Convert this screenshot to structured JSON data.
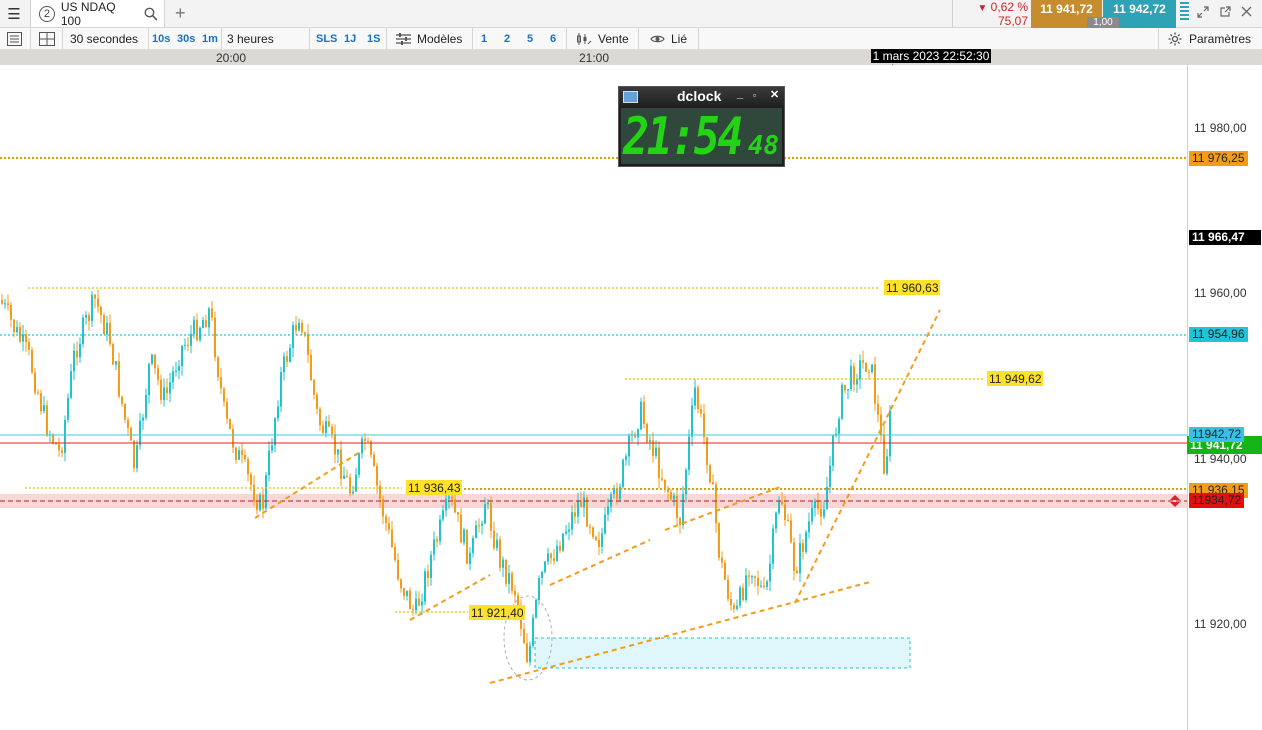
{
  "header": {
    "tab_number": "2",
    "instrument": "US NDAQ 100",
    "change_percent": "0,62 %",
    "change_points": "75,07",
    "bid": "11 941,72",
    "ask": "11 942,72",
    "quantity": "1,00"
  },
  "toolbar": {
    "interval": "30 secondes",
    "btn_10s": "10s",
    "btn_30s": "30s",
    "btn_1m": "1m",
    "range": "3 heures",
    "btn_sls": "SLS",
    "btn_1j": "1J",
    "btn_1s": "1S",
    "models": "Modèles",
    "num1": "1",
    "num2": "2",
    "num5": "5",
    "num6": "6",
    "sale": "Vente",
    "linked": "Lié",
    "settings": "Paramètres"
  },
  "time_axis": {
    "labels": [
      "20:00",
      "21:00"
    ],
    "cursor": "1 mars 2023 22:52:30"
  },
  "dclock": {
    "title": "dclock",
    "time": "21:54",
    "seconds": "48"
  },
  "price_axis": {
    "ticks": [
      "11 980,00",
      "11 960,00",
      "11 940,00",
      "11 920,00"
    ],
    "tags": {
      "top_orange": "11 976,25",
      "black": "11 966,47",
      "cyan": "11 954,96",
      "blue": "11942,72",
      "green": "11 941,72",
      "orange_low": "11 936,15",
      "red": "11934,72"
    }
  },
  "annotations": {
    "a1": "11 960,63",
    "a2": "11 949,62",
    "a3": "11 936,43",
    "a4": "11 921,40"
  },
  "colors": {
    "up": "#22c3cc",
    "down": "#f39c1a",
    "orange_line": "#e8a320",
    "cyan_line": "#22c3d6",
    "red_line": "#e02020",
    "green_tag": "#16b316"
  }
}
